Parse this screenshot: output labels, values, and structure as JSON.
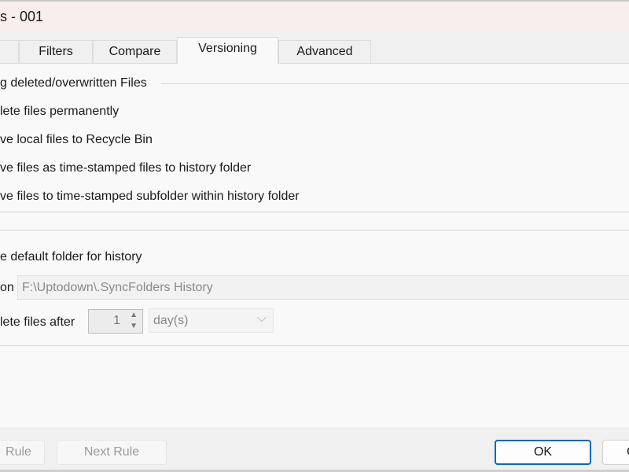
{
  "window": {
    "title": "s - 001"
  },
  "tabs": [
    {
      "label": ""
    },
    {
      "label": "Filters"
    },
    {
      "label": "Compare"
    },
    {
      "label": "Versioning",
      "active": true
    },
    {
      "label": "Advanced"
    }
  ],
  "group1": {
    "title": "g deleted/overwritten Files",
    "options": [
      {
        "label": "lete files permanently"
      },
      {
        "label": "ve local files to Recycle Bin"
      },
      {
        "label": "ve files as time-stamped files to history folder"
      },
      {
        "label": "ve files to time-stamped subfolder within history folder"
      }
    ]
  },
  "group2": {
    "use_default_label": "e default folder for history",
    "location_label": "on",
    "location_value": "F:\\Uptodown\\.SyncFolders History",
    "delete_after_label": "lete files after",
    "delete_after_value": "1",
    "unit_value": "day(s)"
  },
  "footer": {
    "prev_rule": "Rule",
    "next_rule": "Next Rule",
    "ok": "OK",
    "cancel": "C"
  },
  "colors": {
    "accent": "#0067c0"
  }
}
